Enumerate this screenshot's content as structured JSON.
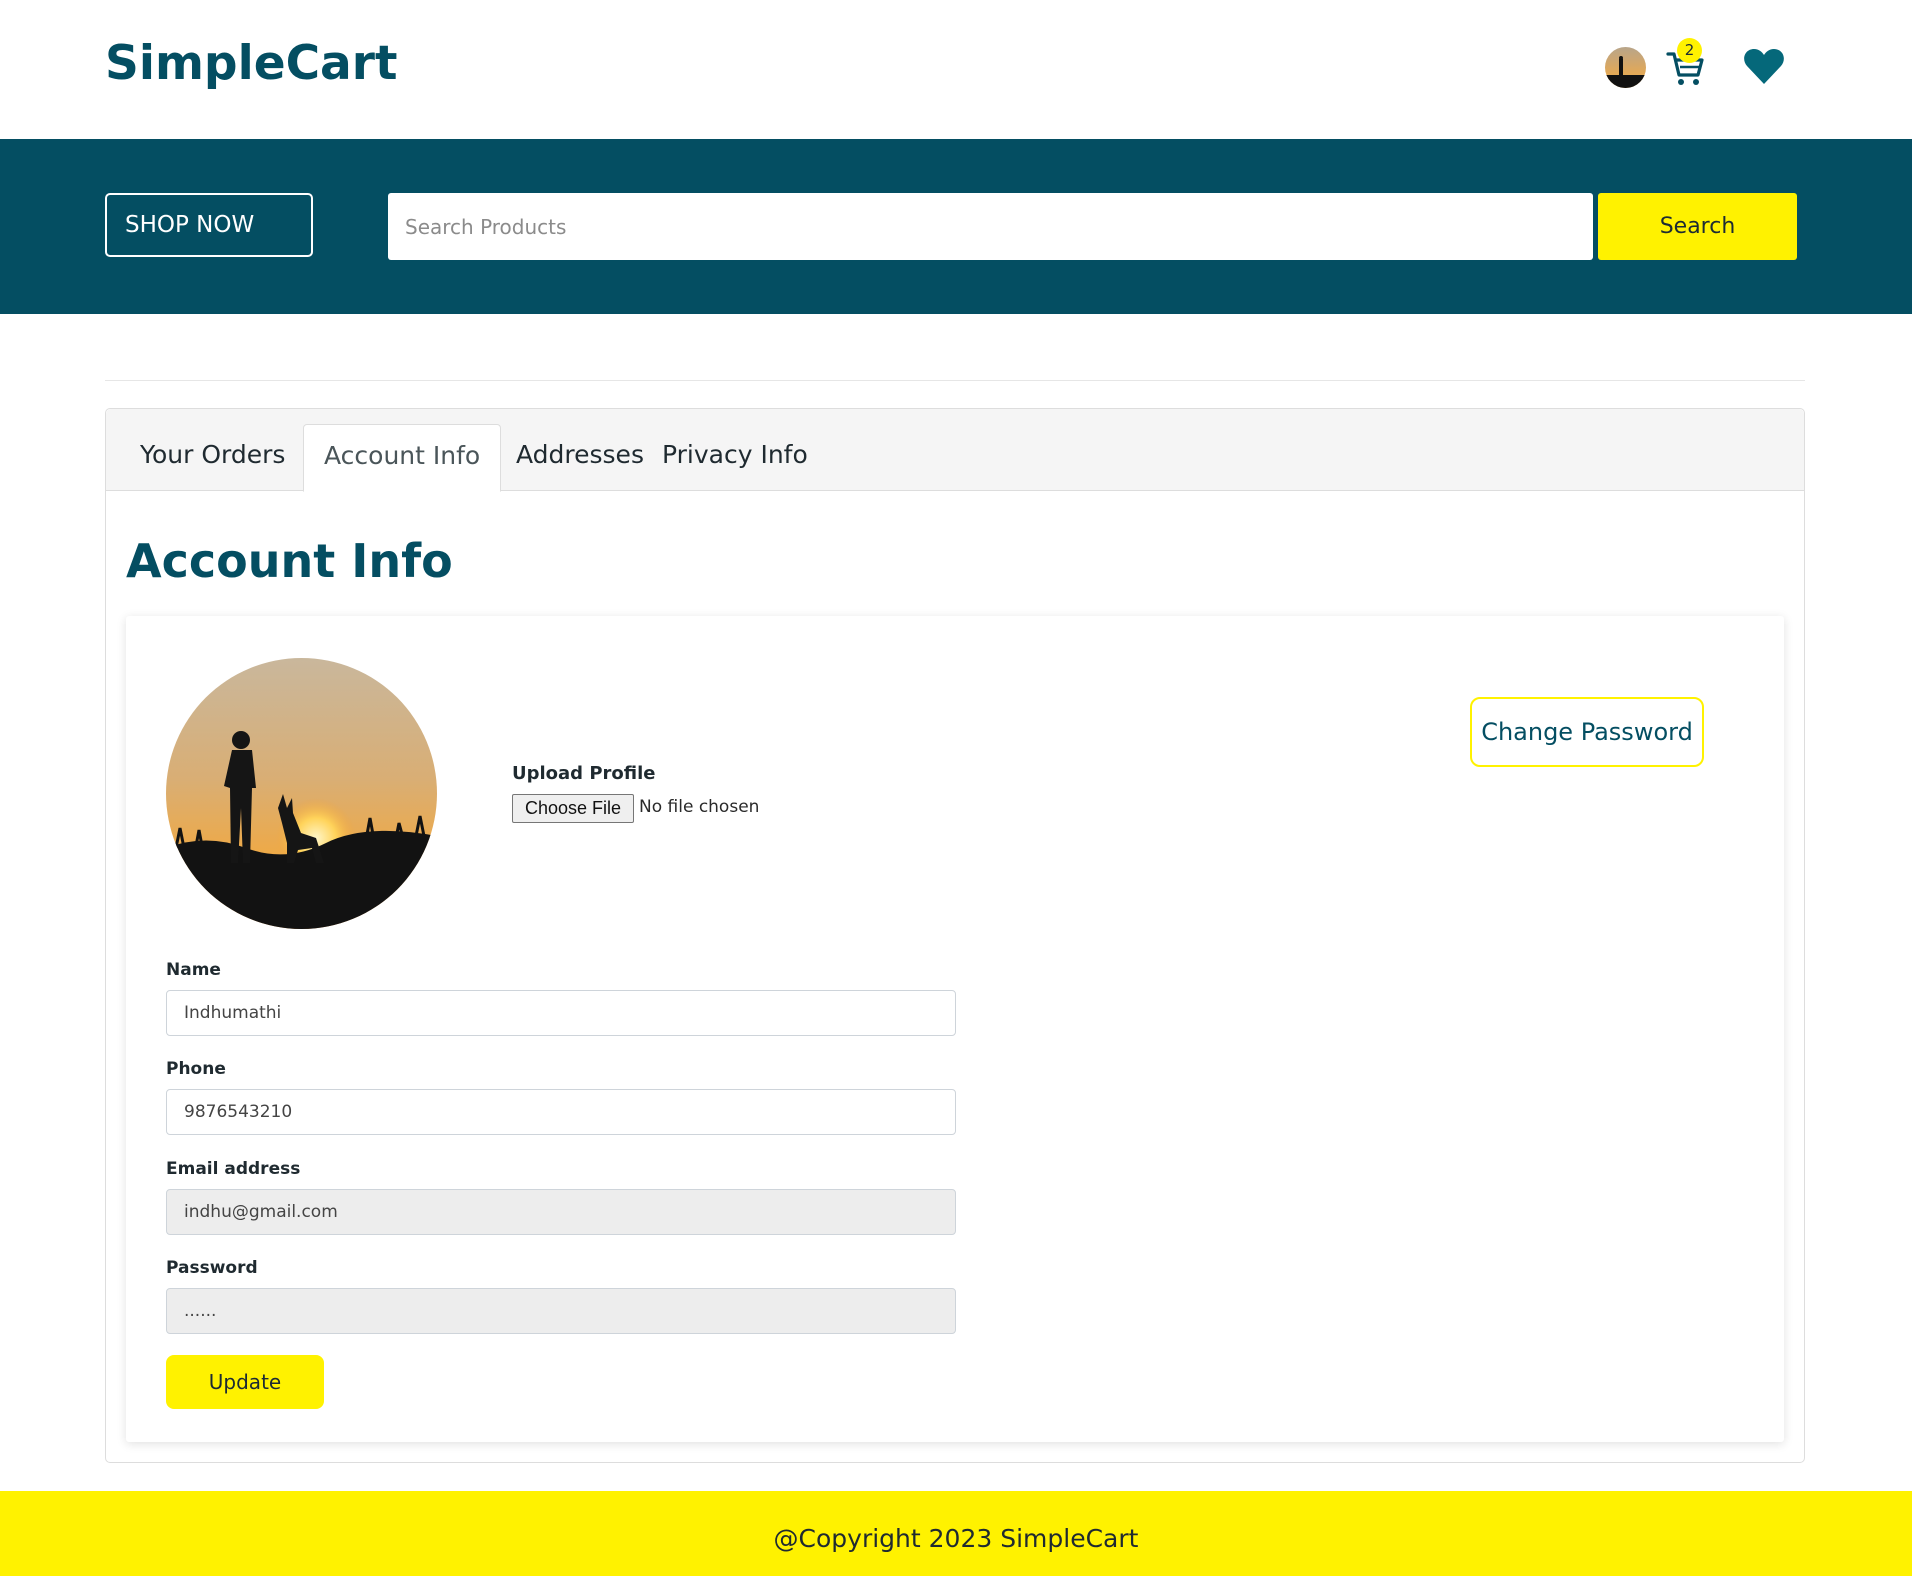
{
  "header": {
    "brand": "SimpleCart",
    "cart_count": "2",
    "icons": [
      "user-avatar",
      "cart-icon",
      "heart-icon"
    ]
  },
  "banner": {
    "shop_now_label": "SHOP NOW",
    "search_placeholder": "Search Products",
    "search_value": "",
    "search_button": "Search"
  },
  "tabs": [
    {
      "label": "Your Orders",
      "active": false
    },
    {
      "label": "Account Info",
      "active": true
    },
    {
      "label": "Addresses",
      "active": false
    },
    {
      "label": "Privacy Info",
      "active": false
    }
  ],
  "account": {
    "title": "Account Info",
    "upload_label": "Upload Profile",
    "choose_file_label": "Choose File",
    "no_file_text": "No file chosen",
    "change_password_label": "Change Password",
    "fields": {
      "name": {
        "label": "Name",
        "value": "Indhumathi"
      },
      "phone": {
        "label": "Phone",
        "value": "9876543210"
      },
      "email": {
        "label": "Email address",
        "value": "indhu@gmail.com"
      },
      "password": {
        "label": "Password",
        "value": "......"
      }
    },
    "update_label": "Update"
  },
  "footer": {
    "text": "@Copyright 2023 SimpleCart"
  },
  "colors": {
    "brand": "#044e62",
    "accent": "#fff200",
    "background": "#ffffff",
    "disabled_input": "#ededed"
  }
}
